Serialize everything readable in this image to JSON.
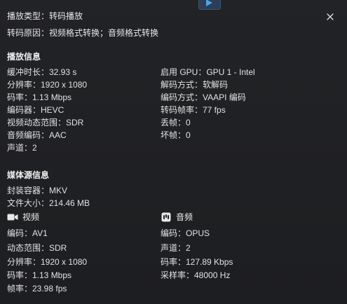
{
  "header": {
    "playback_type": "播放类型：转码播放",
    "transcode_reason": "转码原因：视频格式转换；音频格式转换"
  },
  "playback_info": {
    "title": "播放信息",
    "left": [
      "缓冲时长：32.93 s",
      "分辨率：1920 x 1080",
      "码率：1.13 Mbps",
      "编码器：HEVC",
      "视频动态范围：SDR",
      "音频编码：AAC",
      "声道：2"
    ],
    "right": [
      "启用 GPU：GPU 1 - Intel",
      "解码方式：软解码",
      "编码方式：VAAPI 编码",
      "转码帧率：77 fps",
      "丢帧：0",
      "坏帧：0"
    ]
  },
  "media_info": {
    "title": "媒体源信息",
    "container": "封装容器：MKV",
    "file_size": "文件大小：214.46 MB",
    "video": {
      "label": "视频",
      "icon": "video-camera-icon",
      "lines": [
        "编码：AV1",
        "动态范围：SDR",
        "分辨率：1920 x 1080",
        "码率：1.13 Mbps",
        "帧率：23.98 fps"
      ]
    },
    "audio": {
      "label": "音频",
      "icon": "audio-icon",
      "lines": [
        "编码：OPUS",
        "声道：2",
        "码率：127.89 Kbps",
        "采样率：48000 Hz"
      ]
    }
  }
}
